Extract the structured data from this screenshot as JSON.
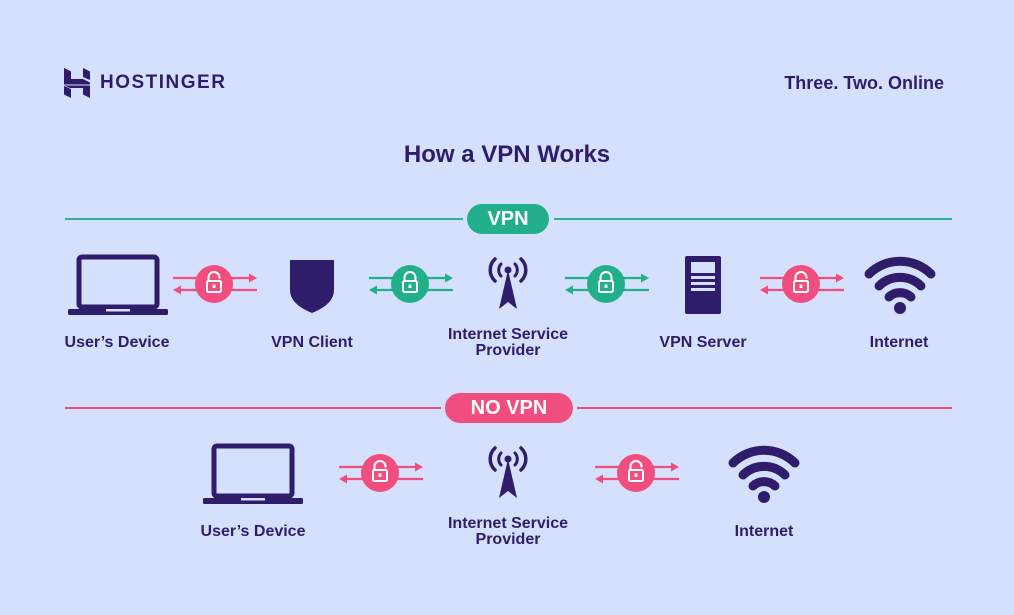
{
  "header": {
    "brand": "HOSTINGER",
    "brand_icon": "hostinger-logo-icon",
    "tagline": "Three. Two. Online"
  },
  "title": "How a VPN Works",
  "colors": {
    "background": "#d5e0fc",
    "primary": "#2f1c6a",
    "secure": "#21b08a",
    "insecure": "#f04e7e"
  },
  "vpn_section": {
    "label": "VPN",
    "nodes": [
      {
        "label": "User’s Device",
        "icon": "laptop-icon"
      },
      {
        "label": "VPN Client",
        "icon": "shield-icon"
      },
      {
        "label_line1": "Internet Service",
        "label_line2": "Provider",
        "icon": "cell-tower-icon"
      },
      {
        "label": "VPN Server",
        "icon": "server-icon"
      },
      {
        "label": "Internet",
        "icon": "wifi-icon"
      }
    ],
    "connections": [
      {
        "status": "unlocked",
        "icon": "unlocked-padlock-icon",
        "color": "#f04e7e"
      },
      {
        "status": "locked",
        "icon": "locked-padlock-icon",
        "color": "#21b08a"
      },
      {
        "status": "locked",
        "icon": "locked-padlock-icon",
        "color": "#21b08a"
      },
      {
        "status": "unlocked",
        "icon": "unlocked-padlock-icon",
        "color": "#f04e7e"
      }
    ]
  },
  "novpn_section": {
    "label": "NO VPN",
    "nodes": [
      {
        "label": "User’s Device",
        "icon": "laptop-icon"
      },
      {
        "label_line1": "Internet Service",
        "label_line2": "Provider",
        "icon": "cell-tower-icon"
      },
      {
        "label": "Internet",
        "icon": "wifi-icon"
      }
    ],
    "connections": [
      {
        "status": "unlocked",
        "icon": "unlocked-padlock-icon",
        "color": "#f04e7e"
      },
      {
        "status": "unlocked",
        "icon": "unlocked-padlock-icon",
        "color": "#f04e7e"
      }
    ]
  }
}
